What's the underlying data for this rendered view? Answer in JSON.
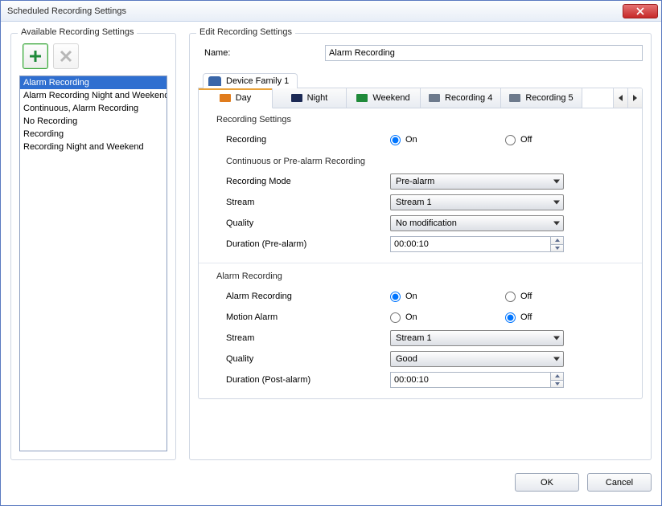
{
  "window": {
    "title": "Scheduled Recording Settings"
  },
  "left": {
    "panel_title": "Available Recording Settings",
    "items": [
      "Alarm Recording",
      "Alarm Recording Night and Weekend",
      "Continuous, Alarm Recording",
      "No Recording",
      "Recording",
      "Recording Night and Weekend"
    ],
    "selected_index": 0
  },
  "right": {
    "panel_title": "Edit Recording Settings",
    "name_label": "Name:",
    "name_value": "Alarm Recording",
    "device_tab": "Device Family 1",
    "subtabs": [
      "Day",
      "Night",
      "Weekend",
      "Recording 4",
      "Recording 5"
    ],
    "form": {
      "section_rec_settings": "Recording Settings",
      "recording_label": "Recording",
      "on_label": "On",
      "off_label": "Off",
      "recording_value": "On",
      "section_cont": "Continuous or Pre-alarm Recording",
      "mode_label": "Recording Mode",
      "mode_value": "Pre-alarm",
      "stream_label": "Stream",
      "stream_value": "Stream 1",
      "quality_label": "Quality",
      "quality_value": "No modification",
      "duration_pre_label": "Duration (Pre-alarm)",
      "duration_pre_value": "00:00:10",
      "section_alarm": "Alarm Recording",
      "alarm_rec_label": "Alarm Recording",
      "alarm_rec_value": "On",
      "motion_label": "Motion Alarm",
      "motion_value": "Off",
      "stream2_label": "Stream",
      "stream2_value": "Stream 1",
      "quality2_label": "Quality",
      "quality2_value": "Good",
      "duration_post_label": "Duration (Post-alarm)",
      "duration_post_value": "00:00:10"
    }
  },
  "footer": {
    "ok": "OK",
    "cancel": "Cancel"
  }
}
